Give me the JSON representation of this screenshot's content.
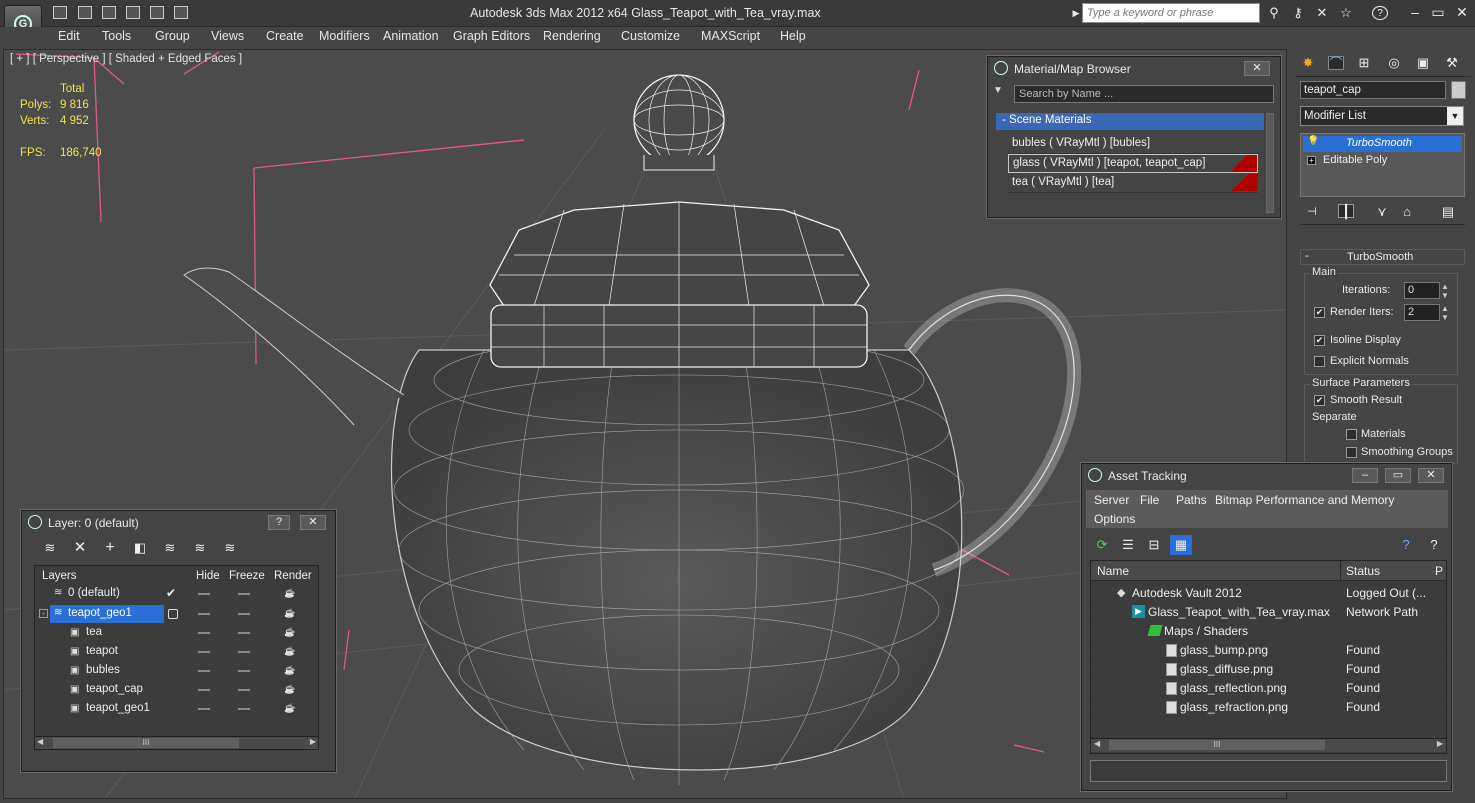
{
  "app": {
    "window_title": "Autodesk 3ds Max  2012 x64     Glass_Teapot_with_Tea_vray.max",
    "search_placeholder": "Type a keyword or phrase"
  },
  "menu": [
    "Edit",
    "Tools",
    "Group",
    "Views",
    "Create",
    "Modifiers",
    "Animation",
    "Graph Editors",
    "Rendering",
    "Customize",
    "MAXScript",
    "Help"
  ],
  "viewport": {
    "label": "[ + ] [ Perspective ] [ Shaded + Edged Faces ]",
    "stats": {
      "total_label": "Total",
      "polys_label": "Polys:",
      "polys_value": "9 816",
      "verts_label": "Verts:",
      "verts_value": "4 952",
      "fps_label": "FPS:",
      "fps_value": "186,740"
    }
  },
  "material_browser": {
    "title": "Material/Map Browser",
    "search_placeholder": "Search by Name ...",
    "section": "- Scene Materials",
    "items": [
      "bubles  ( VRayMtl )  [bubles]",
      "glass  ( VRayMtl )  [teapot, teapot_cap]",
      "tea  ( VRayMtl )  [tea]"
    ],
    "accent": "#b00000"
  },
  "modifier_panel": {
    "object_name": "teapot_cap",
    "modifier_list_label": "Modifier List",
    "stack": [
      "TurboSmooth",
      "Editable Poly"
    ],
    "rollout_title": "TurboSmooth",
    "main_label": "Main",
    "iterations_label": "Iterations:",
    "iterations_value": "0",
    "render_iters_label": "Render Iters:",
    "render_iters_value": "2",
    "isoline": "Isoline Display",
    "explicit_normals": "Explicit Normals",
    "surface_params": "Surface Parameters",
    "smooth_result": "Smooth Result",
    "separate": "Separate",
    "materials": "Materials",
    "smoothing_groups": "Smoothing Groups",
    "selection_color": "#2a6fd6"
  },
  "layer_panel": {
    "title": "Layer: 0 (default)",
    "columns": [
      "Layers",
      "Hide",
      "Freeze",
      "Render"
    ],
    "rows": [
      "0 (default)",
      "teapot_geo1",
      "tea",
      "teapot",
      "bubles",
      "teapot_cap",
      "teapot_geo1"
    ],
    "scroll_mark": "III"
  },
  "asset_tracking": {
    "title": "Asset Tracking",
    "menus": [
      "Server",
      "File",
      "Paths",
      "Bitmap Performance and Memory",
      "Options"
    ],
    "columns": [
      "Name",
      "Status",
      "P"
    ],
    "rows": [
      {
        "name": "Autodesk Vault 2012",
        "status": "Logged Out (..."
      },
      {
        "name": "Glass_Teapot_with_Tea_vray.max",
        "status": "Network Path"
      },
      {
        "name": "Maps / Shaders",
        "status": ""
      },
      {
        "name": "glass_bump.png",
        "status": "Found"
      },
      {
        "name": "glass_diffuse.png",
        "status": "Found"
      },
      {
        "name": "glass_reflection.png",
        "status": "Found"
      },
      {
        "name": "glass_refraction.png",
        "status": "Found"
      }
    ],
    "scroll_mark": "III"
  }
}
